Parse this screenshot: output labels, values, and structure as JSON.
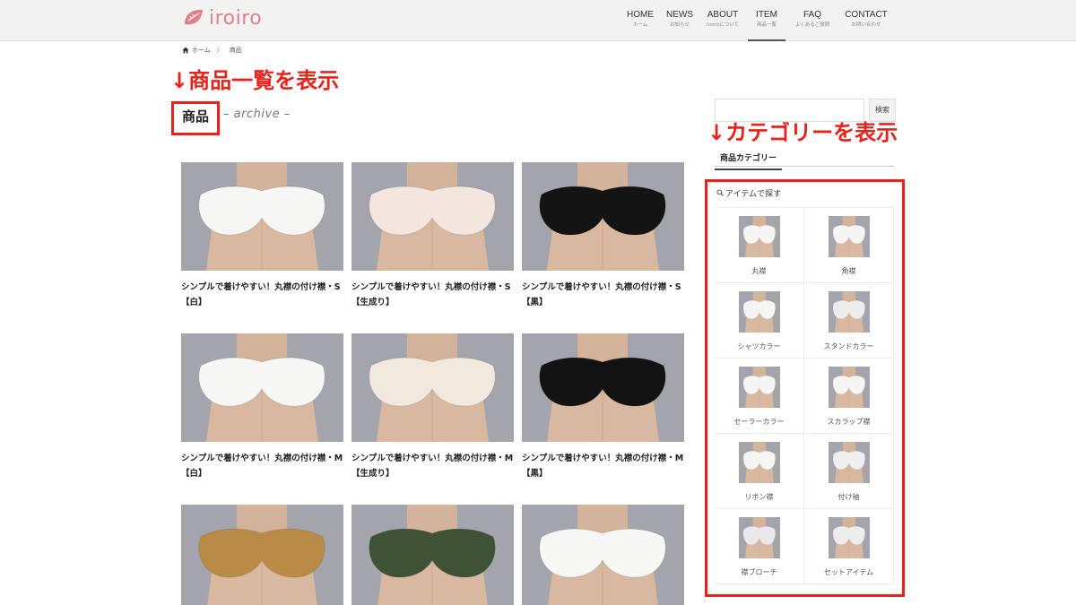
{
  "header": {
    "logo_text": "iroiro",
    "nav": [
      {
        "en": "HOME",
        "ja": "ホーム",
        "active": false
      },
      {
        "en": "NEWS",
        "ja": "お知らせ",
        "active": false
      },
      {
        "en": "ABOUT",
        "ja": "iroiroについて",
        "active": false
      },
      {
        "en": "ITEM",
        "ja": "商品一覧",
        "active": true
      },
      {
        "en": "FAQ",
        "ja": "よくあるご質問",
        "active": false
      },
      {
        "en": "CONTACT",
        "ja": "お問い合わせ",
        "active": false
      }
    ]
  },
  "breadcrumb": {
    "home": "ホーム",
    "sep": "〉",
    "current": "商品"
  },
  "annotations": {
    "list": "↓商品一覧を表示",
    "category": "↓カテゴリーを表示"
  },
  "page": {
    "title": "商品",
    "subtitle": "– archive –"
  },
  "products": [
    {
      "title": "シンプルで着けやすい！丸襟の付け襟・S【白】",
      "collar_color": "#f6f6f4"
    },
    {
      "title": "シンプルで着けやすい！丸襟の付け襟・S【生成り】",
      "collar_color": "#f2e6df"
    },
    {
      "title": "シンプルで着けやすい！丸襟の付け襟・S【黒】",
      "collar_color": "#141414"
    },
    {
      "title": "シンプルで着けやすい！丸襟の付け襟・M【白】",
      "collar_color": "#f6f6f4"
    },
    {
      "title": "シンプルで着けやすい！丸襟の付け襟・M【生成り】",
      "collar_color": "#f1e8de"
    },
    {
      "title": "シンプルで着けやすい！丸襟の付け襟・M【黒】",
      "collar_color": "#131313"
    },
    {
      "title": "",
      "collar_color": "#b98b45"
    },
    {
      "title": "",
      "collar_color": "#3f5236"
    },
    {
      "title": "",
      "collar_color": "#f7f7f5"
    }
  ],
  "sidebar": {
    "search_button": "検索",
    "category_heading": "商品カテゴリー",
    "panel_title": "アイテムで探す",
    "categories": [
      {
        "label": "丸襟",
        "collar_color": "#f5f5f3"
      },
      {
        "label": "角襟",
        "collar_color": "#f5f5f3"
      },
      {
        "label": "シャツカラー",
        "collar_color": "#f5f5f3"
      },
      {
        "label": "スタンドカラー",
        "collar_color": "#ececec"
      },
      {
        "label": "セーラーカラー",
        "collar_color": "#f5f5f3"
      },
      {
        "label": "スカラップ襟",
        "collar_color": "#f5f5f3"
      },
      {
        "label": "リボン襟",
        "collar_color": "#f5f5f3"
      },
      {
        "label": "付け袖",
        "collar_color": "#efefef"
      },
      {
        "label": "襟ブローチ",
        "collar_color": "#e9e9ec"
      },
      {
        "label": "セットアイテム",
        "collar_color": "#ededed"
      }
    ]
  },
  "colors": {
    "accent": "#e8221b",
    "logo": "#e0808a"
  }
}
